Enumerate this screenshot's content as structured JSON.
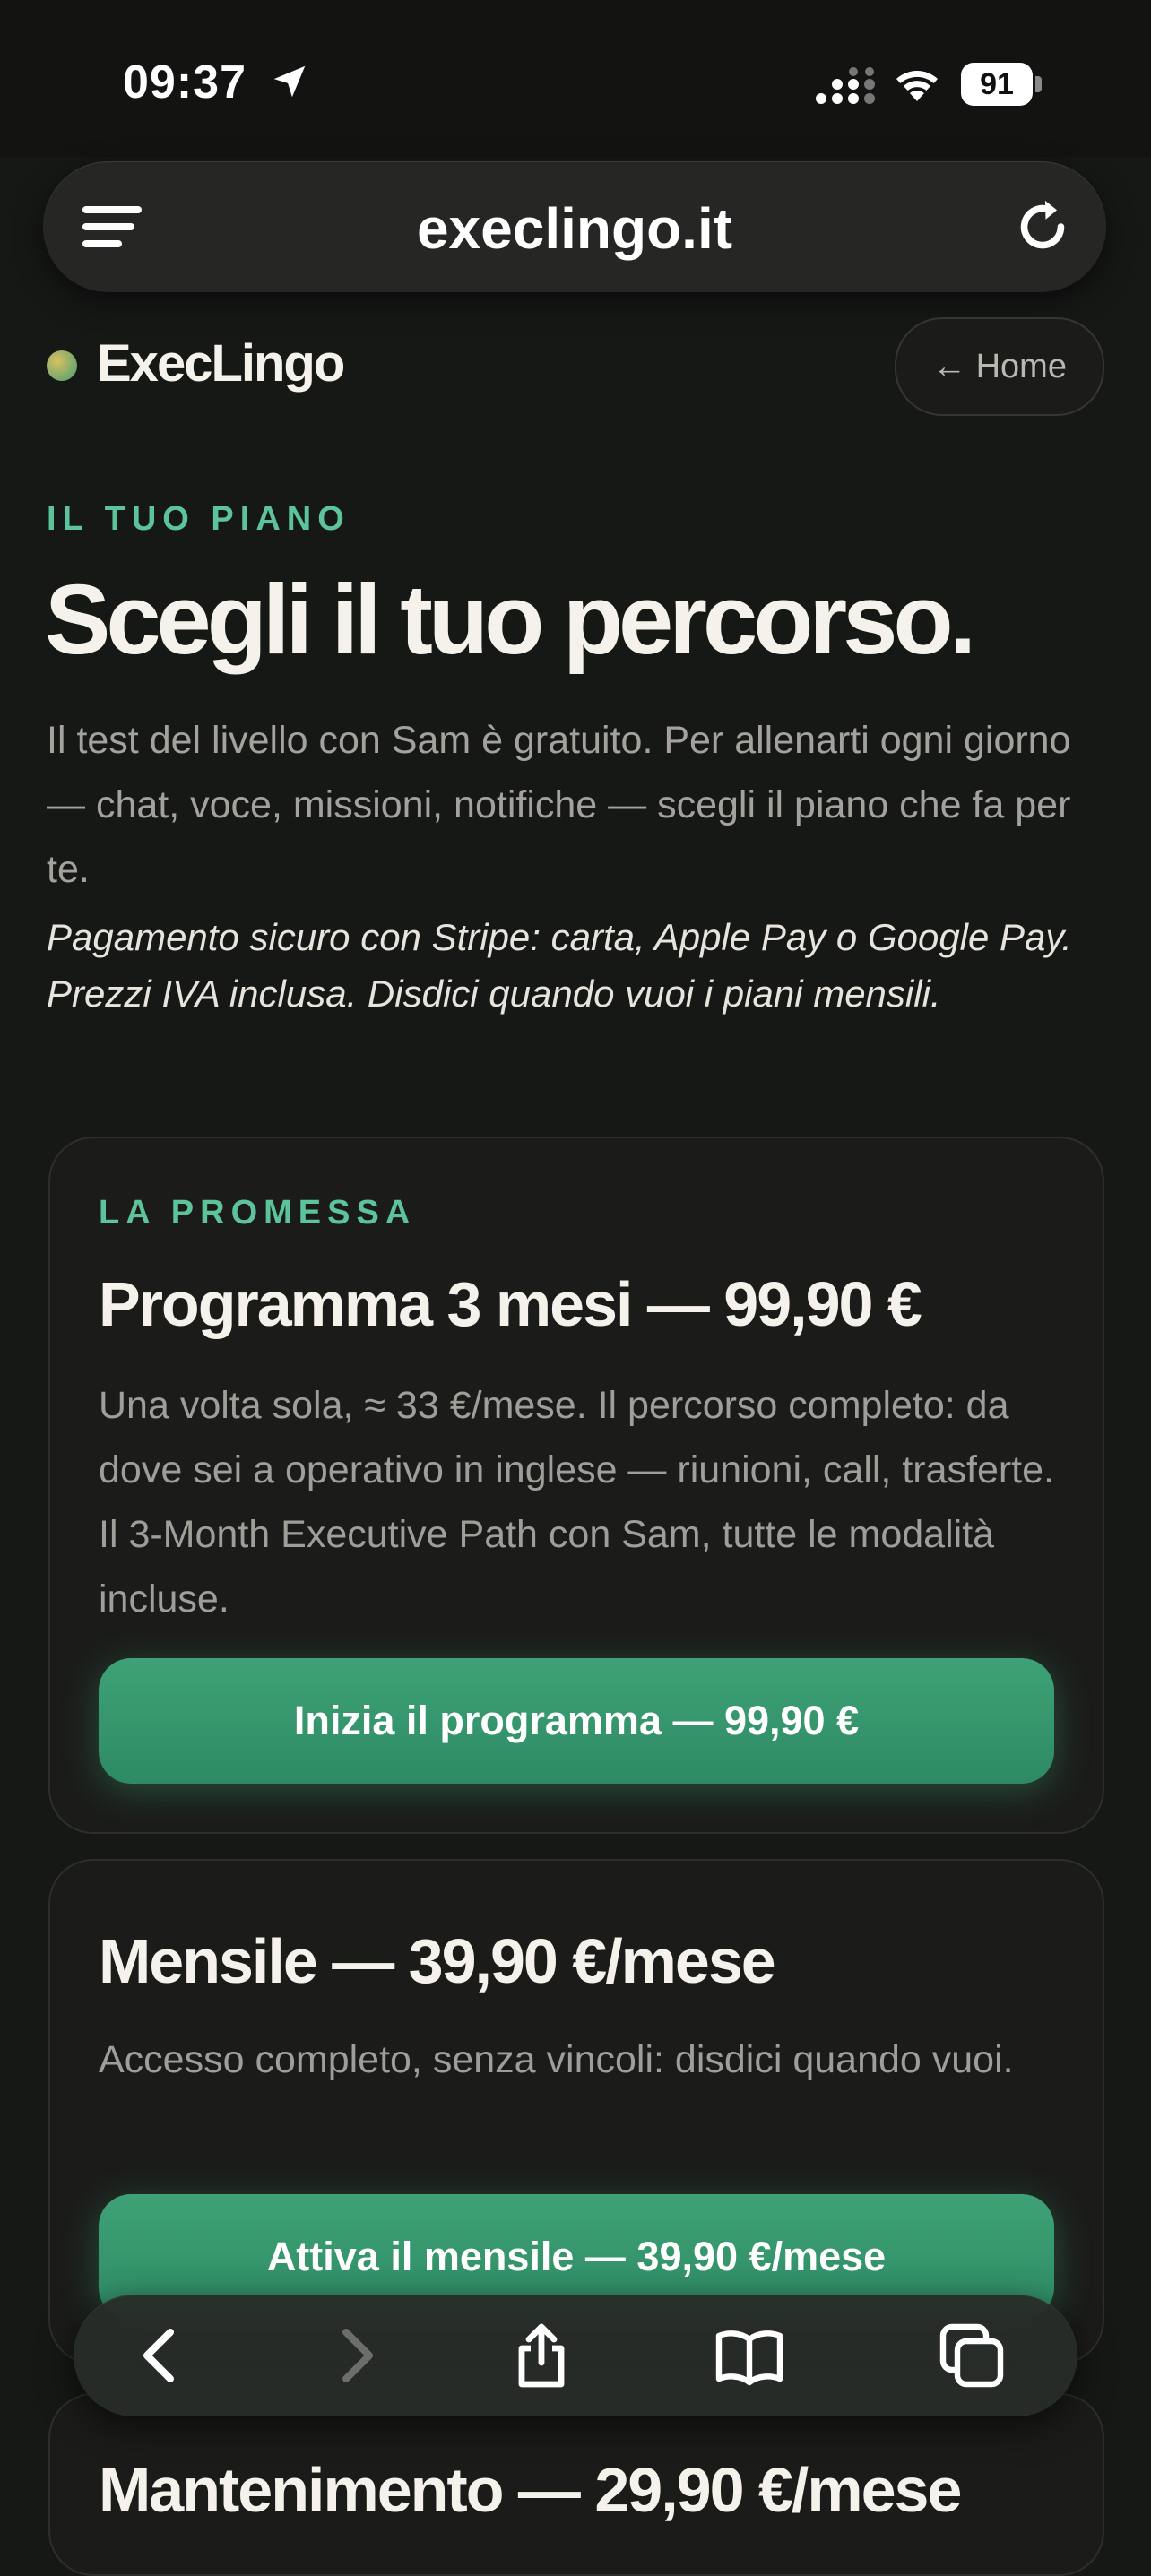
{
  "status_bar": {
    "time": "09:37",
    "battery": "91"
  },
  "browser": {
    "url": "execlingo.it"
  },
  "header": {
    "brand": "ExecLingo",
    "home_button": "← Home"
  },
  "intro": {
    "eyebrow": "IL TUO PIANO",
    "title": "Scegli il tuo percorso.",
    "description": "Il test del livello con Sam è gratuito. Per allenarti ogni giorno — chat, voce, missioni, notifiche — scegli il piano che fa per te.",
    "note": "Pagamento sicuro con Stripe: carta, Apple Pay o Google Pay. Prezzi IVA inclusa. Disdici quando vuoi i piani mensili."
  },
  "plans": [
    {
      "eyebrow": "LA PROMESSA",
      "title": "Programma 3 mesi — 99,90 €",
      "description": "Una volta sola, ≈ 33 €/mese. Il percorso completo: da dove sei a operativo in inglese — riunioni, call, trasferte. Il 3-Month Executive Path con Sam, tutte le modalità incluse.",
      "cta": "Inizia il programma — 99,90 €"
    },
    {
      "title": "Mensile — 39,90 €/mese",
      "description": "Accesso completo, senza vincoli: disdici quando vuoi.",
      "cta": "Attiva il mensile — 39,90 €/mese"
    },
    {
      "title": "Mantenimento — 29,90 €/mese"
    }
  ],
  "toolbar": {
    "icons": [
      "back-icon",
      "forward-icon",
      "share-icon",
      "bookmarks-icon",
      "tabs-icon"
    ]
  },
  "colors": {
    "accent": "#5cc39a",
    "cta": "#3ea276",
    "background": "#161816"
  }
}
